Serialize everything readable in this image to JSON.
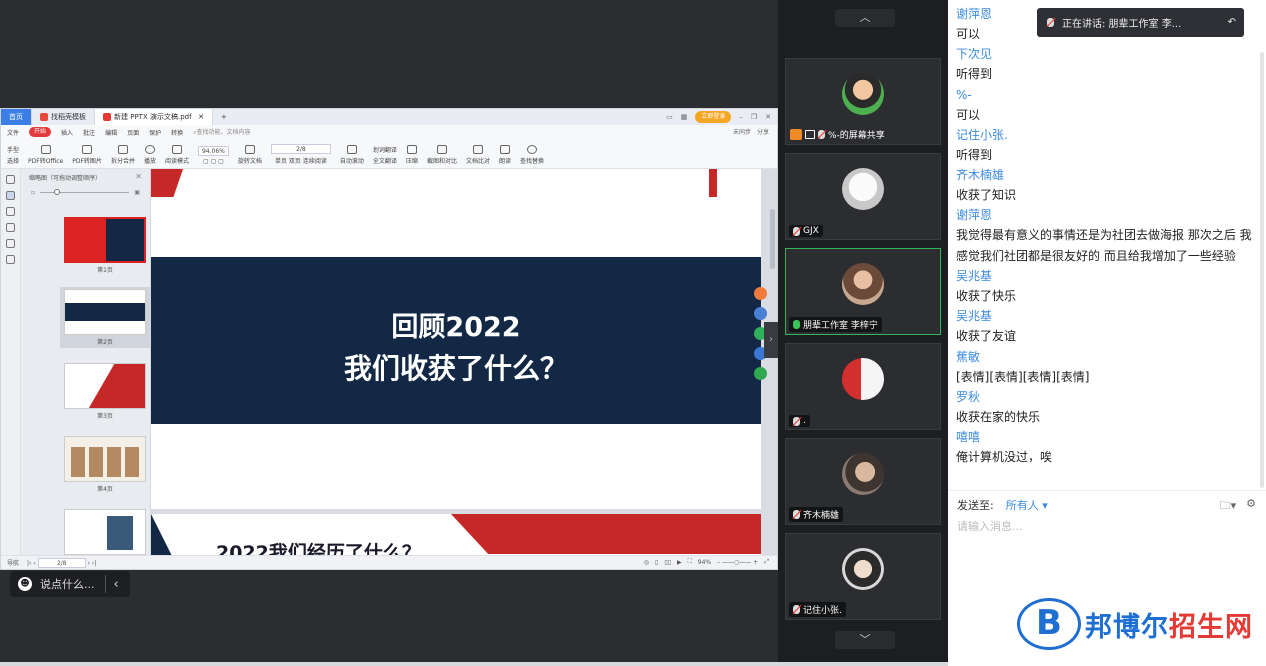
{
  "wps": {
    "tabs": {
      "home": "首页",
      "template": "找稻壳模板",
      "doc": "新建 PPTX 演示文稿.pdf",
      "add": "+"
    },
    "login": "立即登录",
    "menu": {
      "file": "文件",
      "items": [
        "开始",
        "插入",
        "批注",
        "编辑",
        "页面",
        "保护",
        "转换"
      ],
      "search": "查找功能、文档内容",
      "right": [
        "未同步",
        "分享"
      ]
    },
    "toolbar": {
      "hand": "手型",
      "select": "选择",
      "to_office": "PDF转Office",
      "to_image": "PDF转图片",
      "split": "拆分合并",
      "play": "播放",
      "read_mode": "阅读模式",
      "zoom": "94.06%",
      "page": "2/8",
      "rotate": "旋转文档",
      "single": "单页",
      "double": "双页",
      "continuous": "连续阅读",
      "auto_scroll": "自动滚动",
      "translate": "划词翻译",
      "full_translate": "全文翻译",
      "compress": "压缩",
      "crop": "截图和对比",
      "compare": "文档比对",
      "read": "朗读",
      "find_replace": "查找替换"
    },
    "thumbs": {
      "title": "缩略图（可拖动调整顺序）",
      "captions": [
        "第1页",
        "第2页",
        "第3页",
        "第4页"
      ]
    },
    "slide": {
      "line1": "回顾2022",
      "line2": "我们收获了什么？",
      "next_title": "2022我们经历了什么？"
    },
    "status": {
      "nav": "导航",
      "page": "2/8",
      "zoom": "94%"
    }
  },
  "say_placeholder": "说点什么...",
  "participants": [
    {
      "name": "%-的屏幕共享",
      "mic": "off",
      "sharing": true
    },
    {
      "name": "GJX",
      "mic": "off"
    },
    {
      "name": "朋辈工作室 李梓宁",
      "mic": "on",
      "active": true
    },
    {
      "name": ".",
      "mic": "off"
    },
    {
      "name": "齐木楠雄",
      "mic": "off"
    },
    {
      "name": "记住小张.",
      "mic": "off"
    }
  ],
  "speaking": "正在讲话: 朋辈工作室 李...",
  "chat": [
    {
      "name": "谢萍恩",
      "text": "可以"
    },
    {
      "name": "下次见",
      "text": "听得到"
    },
    {
      "name": "%-",
      "text": "可以"
    },
    {
      "name": "记住小张.",
      "text": "听得到"
    },
    {
      "name": "齐木楠雄",
      "text": "收获了知识"
    },
    {
      "name": "谢萍恩",
      "text": "我觉得最有意义的事情还是为社团去做海报 那次之后 我感觉我们社团都是很友好的 而且给我增加了一些经验"
    },
    {
      "name": "吴兆基",
      "text": "收获了快乐"
    },
    {
      "name": "吴兆基",
      "text": "收获了友谊"
    },
    {
      "name": "蕉敏",
      "text": "[表情][表情][表情][表情]"
    },
    {
      "name": "罗秋",
      "text": "收获在家的快乐"
    },
    {
      "name": "嘻嘻",
      "text": "俺计算机没过，唉"
    }
  ],
  "send": {
    "label": "发送至:",
    "target": "所有人",
    "placeholder": "请输入消息..."
  },
  "watermark": {
    "letter": "B",
    "text1": "邦博尔",
    "text2": "招生网"
  },
  "colors": {
    "chat_name": "#3b8be0",
    "slide_band": "#132844",
    "accent_red": "#e4393c",
    "active_border": "#35b35a"
  }
}
